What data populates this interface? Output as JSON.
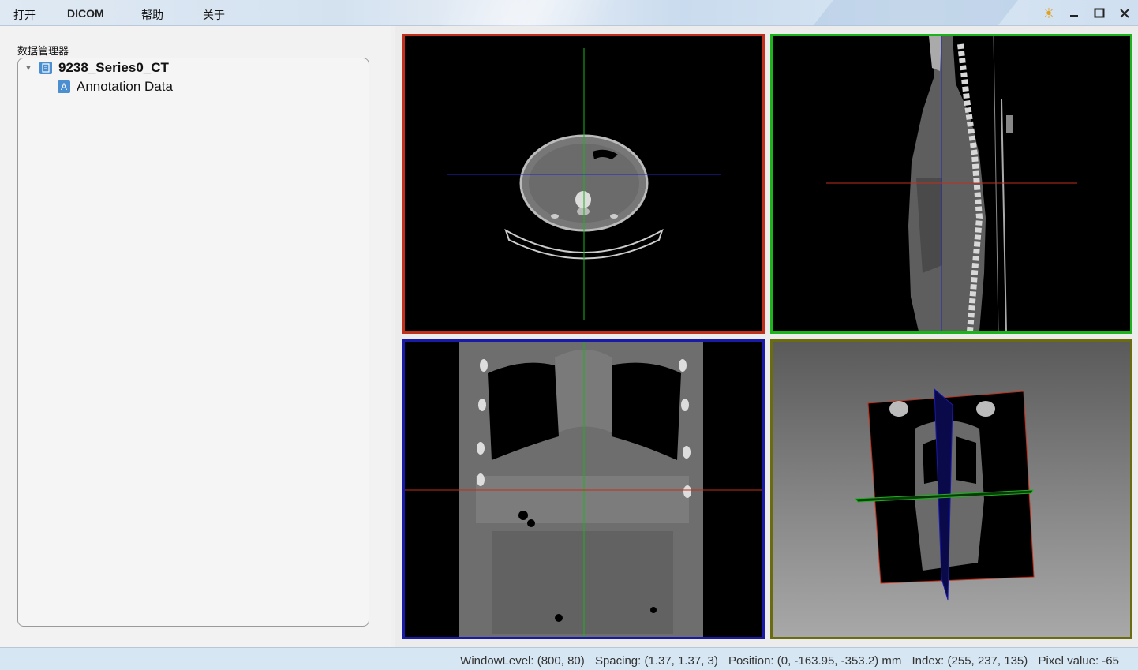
{
  "menu": {
    "open": "打开",
    "dicom": "DICOM",
    "help": "帮助",
    "about": "关于"
  },
  "window_controls": {
    "theme": "☀",
    "minimize": "—",
    "maximize": "☐",
    "close": "✕"
  },
  "data_manager": {
    "title": "数据管理器",
    "series": {
      "label": "9238_Series0_CT",
      "icon": "C"
    },
    "annotation": {
      "label": "Annotation Data",
      "icon": "A"
    }
  },
  "viewports": {
    "axial": {
      "border_color": "#c0301c"
    },
    "sagittal": {
      "border_color": "#1db31d"
    },
    "coronal": {
      "border_color": "#1a1aa8"
    },
    "three_d": {
      "border_color": "#6b6b10"
    }
  },
  "status": {
    "window_level": "WindowLevel: (800, 80)",
    "spacing": "Spacing: (1.37, 1.37, 3)",
    "position": "Position: (0, -163.95, -353.2) mm",
    "index": "Index: (255, 237, 135)",
    "pixel_value": "Pixel value: -65"
  }
}
